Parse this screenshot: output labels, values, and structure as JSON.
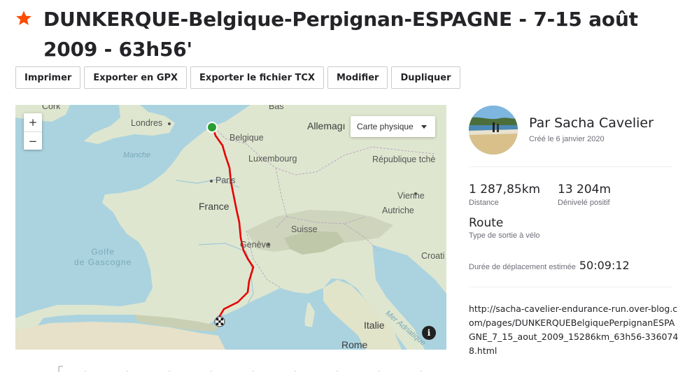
{
  "header": {
    "title": "DUNKERQUE-Belgique-Perpignan-ESPAGNE - 7-15 août 2009 - 63h56'",
    "star_icon": "star-icon",
    "star_color": "#fc4c02"
  },
  "toolbar": {
    "buttons": [
      "Imprimer",
      "Exporter en GPX",
      "Exporter le fichier TCX",
      "Modifier",
      "Dupliquer"
    ]
  },
  "map": {
    "zoom_in": "+",
    "zoom_out": "−",
    "map_type": "Carte physique",
    "info": "i",
    "route_color": "#e60000",
    "start_color": "#2a9d33",
    "labels": {
      "cork": "Cork",
      "londres": "Londres",
      "bas": "Bas",
      "allemagne": "Allemagı",
      "belgique": "Belgique",
      "luxembourg": "Luxembourg",
      "republique_tcheque": "République tchè",
      "manche": "Manche",
      "paris": "Paris",
      "france": "France",
      "vienne": "Vienne",
      "autriche": "Autriche",
      "suisse": "Suisse",
      "golfe_de_gascogne": "Golfe\nde Gascogne",
      "geneve": "Genève",
      "croatie": "Croati",
      "mer_adriatique": "Mer Adriatique",
      "italie": "Italie",
      "rome": "Rome"
    }
  },
  "profile": {
    "author": "Par Sacha Cavelier",
    "created": "Créé le 6 janvier 2020",
    "avatar_icon": "avatar"
  },
  "stats": {
    "distance_value": "1 287,85km",
    "distance_label": "Distance",
    "elevation_value": "13 204m",
    "elevation_label": "Dénivelé positif",
    "route_type": "Route",
    "route_subtype": "Type de sortie à vélo",
    "duration_label": "Durée de déplacement estimée",
    "duration_value": "50:09:12"
  },
  "description": {
    "link": "http://sacha-cavelier-endurance-run.over-blog.com/pages/DUNKERQUEBelgiquePerpignanESPAGNE_7_15_aout_2009_15286km_63h56-3360748.html"
  }
}
